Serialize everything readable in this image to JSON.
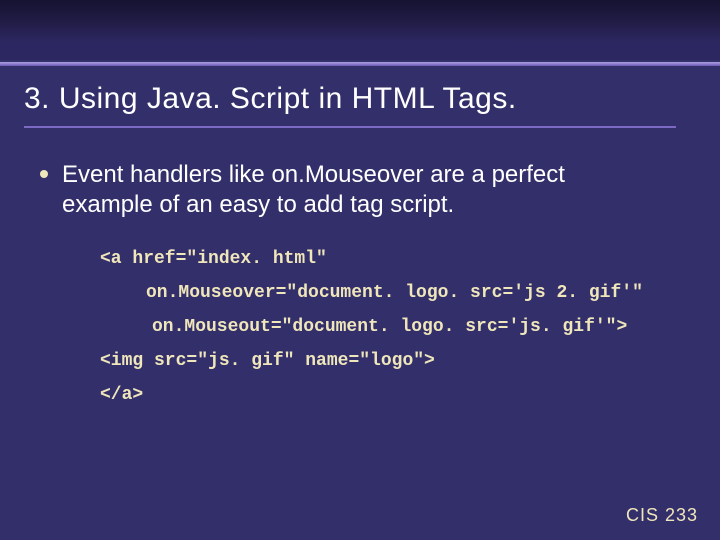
{
  "header": {
    "title": "3.  Using Java. Script in HTML Tags."
  },
  "bullet": {
    "text": "Event handlers like on.Mouseover are a perfect example of an easy to add tag script."
  },
  "code": {
    "line1": "<a href=\"index. html\"",
    "line2": "on.Mouseover=\"document. logo. src='js 2. gif'\"",
    "line3": "on.Mouseout=\"document. logo. src='js. gif'\">",
    "line4": "<img src=\"js. gif\" name=\"logo\">",
    "line5": "</a>"
  },
  "footer": {
    "course": "CIS 233"
  }
}
